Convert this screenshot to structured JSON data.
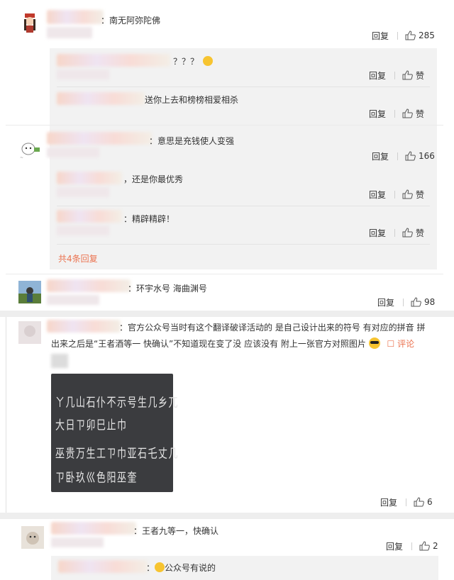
{
  "comments": [
    {
      "text": "：南无阿弥陀佛",
      "reply": "回复",
      "likes": "285",
      "replies": [
        {
          "text": "？？？",
          "reply": "回复",
          "likes": "赞"
        },
        {
          "text": "送你上去和榜榜相爱相杀",
          "reply": "回复",
          "likes": "赞"
        }
      ]
    },
    {
      "text": "：意思是充钱使人变强",
      "reply": "回复",
      "likes": "166",
      "replies": [
        {
          "text": "，还是你最优秀",
          "reply": "回复",
          "likes": "赞"
        },
        {
          "text": "：精辟精辟！",
          "reply": "回复",
          "likes": "赞"
        }
      ],
      "more": "共4条回复"
    },
    {
      "text": "：环宇水号 海曲渊号",
      "reply": "回复",
      "likes": "98"
    },
    {
      "text_line1": "：官方公众号当时有这个翻译破译活动的 是自己设计出来的符号 有对应的拼音 拼",
      "text_line2": "出来之后是“王者酒等一 快确认”不知道现在变了没 应该没有 附上一张官方对照图片",
      "comment_link": "评论",
      "reply": "回复",
      "likes": "6",
      "image_rows": [
        "ㄚ几山石仆不示号生几乡兀",
        "大日ㄗ卯巳止巾",
        "巫贵万生工ㄗ巾亚石乇丈几",
        "ㄗ卧玖巛色阳巫奎"
      ]
    },
    {
      "text": "：王者九等一，快确认",
      "reply": "回复",
      "likes": "2",
      "replies": [
        {
          "text": "公众号有说的"
        }
      ]
    }
  ],
  "colors": {
    "accent": "#eb7350",
    "separator": "#eeeeee",
    "subbox": "#f2f2f2"
  },
  "icons": {
    "like": "thumbs-up-icon",
    "emoji": "smile-emoji-icon",
    "cool": "sunglasses-emoji-icon",
    "comment": "comment-icon"
  }
}
